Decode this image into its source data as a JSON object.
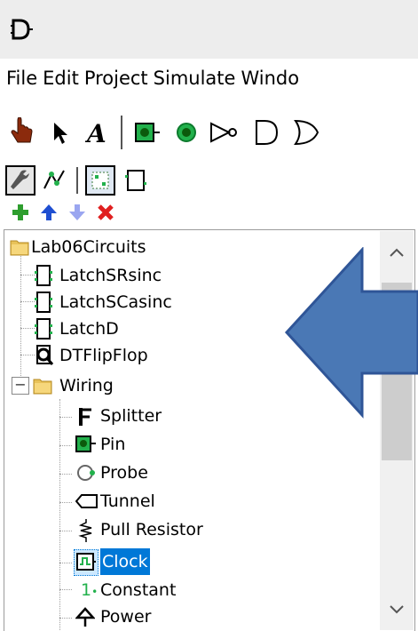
{
  "menu": {
    "items": [
      "File",
      "Edit",
      "Project",
      "Simulate",
      "Windo"
    ]
  },
  "tree": {
    "root_label": "Lab06Circuits",
    "circuits": [
      {
        "label": "LatchSRsinc",
        "icon": "circuit-icon"
      },
      {
        "label": "LatchSCasinc",
        "icon": "circuit-icon"
      },
      {
        "label": "LatchD",
        "icon": "circuit-icon"
      },
      {
        "label": "DTFlipFlop",
        "icon": "circuit-magnify-icon"
      }
    ],
    "folder_label": "Wiring",
    "folder_toggle": "−",
    "wiring_items": [
      {
        "label": "Splitter",
        "icon": "splitter-icon"
      },
      {
        "label": "Pin",
        "icon": "pin-icon"
      },
      {
        "label": "Probe",
        "icon": "probe-icon"
      },
      {
        "label": "Tunnel",
        "icon": "tunnel-icon"
      },
      {
        "label": "Pull Resistor",
        "icon": "resistor-icon"
      },
      {
        "label": "Clock",
        "icon": "clock-icon",
        "selected": true
      },
      {
        "label": "Constant",
        "icon": "constant-icon"
      },
      {
        "label": "Power",
        "icon": "power-icon"
      }
    ],
    "constant_glyph": "1"
  },
  "colors": {
    "selection": "#0078d7",
    "arrow_fill": "#4a78b5",
    "arrow_stroke": "#2f5597",
    "gate_green": "#22b14c",
    "add_green": "#2e9e2e",
    "up_blue": "#1f4fd1",
    "down_blue": "#9aa6f0",
    "delete_red": "#e02020"
  }
}
